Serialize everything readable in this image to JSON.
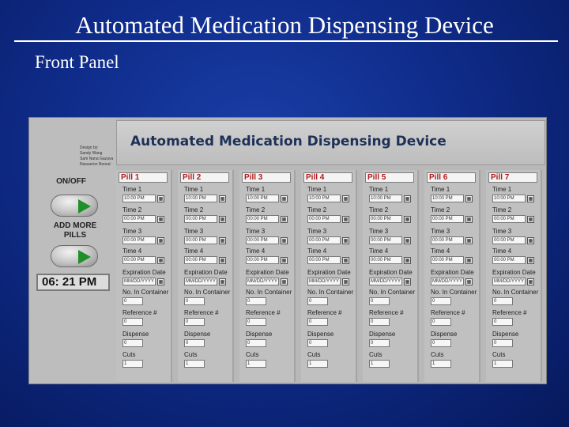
{
  "slide": {
    "title": "Automated Medication Dispensing Device",
    "subtitle": "Front Panel"
  },
  "panel": {
    "title": "Automated Medication Dispensing Device",
    "info_lines": [
      "Design by:",
      "Sandy Wang",
      "Sam Nana Gazava",
      "Nassarion Nooral"
    ],
    "on_off_label": "ON/OFF",
    "add_more_label_1": "ADD MORE",
    "add_more_label_2": "PILLS",
    "clock": "06: 21 PM",
    "led_color": "#1f8f2a",
    "pill_name_color": "#b0191b"
  },
  "field_labels": {
    "time1": "Time 1",
    "time2": "Time 2",
    "time3": "Time 3",
    "time4": "Time 4",
    "expiration": "Expiration Date",
    "num_container": "No. In Container",
    "reference": "Reference #",
    "dispense": "Dispense",
    "cuts": "Cuts"
  },
  "pills": [
    {
      "name": "Pill 1",
      "time1": "10:00 PM",
      "time2": "00:00 PM",
      "time3": "00:00 PM",
      "time4": "00:00 PM",
      "expiration": "MM/DD/YYYY",
      "num": "0",
      "ref": "0",
      "dispense": "0",
      "cuts": "1"
    },
    {
      "name": "Pill 2",
      "time1": "10:00 PM",
      "time2": "00:00 PM",
      "time3": "00:00 PM",
      "time4": "00:00 PM",
      "expiration": "MM/DD/YYYY",
      "num": "0",
      "ref": "0",
      "dispense": "0",
      "cuts": "1"
    },
    {
      "name": "Pill 3",
      "time1": "10:00 PM",
      "time2": "00:00 PM",
      "time3": "00:00 PM",
      "time4": "00:00 PM",
      "expiration": "MM/DD/YYYY",
      "num": "0",
      "ref": "0",
      "dispense": "0",
      "cuts": "1"
    },
    {
      "name": "Pill 4",
      "time1": "10:00 PM",
      "time2": "00:00 PM",
      "time3": "00:00 PM",
      "time4": "00:00 PM",
      "expiration": "MM/DD/YYYY",
      "num": "0",
      "ref": "0",
      "dispense": "0",
      "cuts": "1"
    },
    {
      "name": "Pill 5",
      "time1": "10:00 PM",
      "time2": "00:00 PM",
      "time3": "00:00 PM",
      "time4": "00:00 PM",
      "expiration": "MM/DD/YYYY",
      "num": "0",
      "ref": "0",
      "dispense": "0",
      "cuts": "1"
    },
    {
      "name": "Pill 6",
      "time1": "10:00 PM",
      "time2": "00:00 PM",
      "time3": "00:00 PM",
      "time4": "00:00 PM",
      "expiration": "MM/DD/YYYY",
      "num": "0",
      "ref": "0",
      "dispense": "0",
      "cuts": "1"
    },
    {
      "name": "Pill 7",
      "time1": "10:00 PM",
      "time2": "00:00 PM",
      "time3": "00:00 PM",
      "time4": "00:00 PM",
      "expiration": "MM/DD/YYYY",
      "num": "0",
      "ref": "0",
      "dispense": "0",
      "cuts": "1"
    }
  ]
}
